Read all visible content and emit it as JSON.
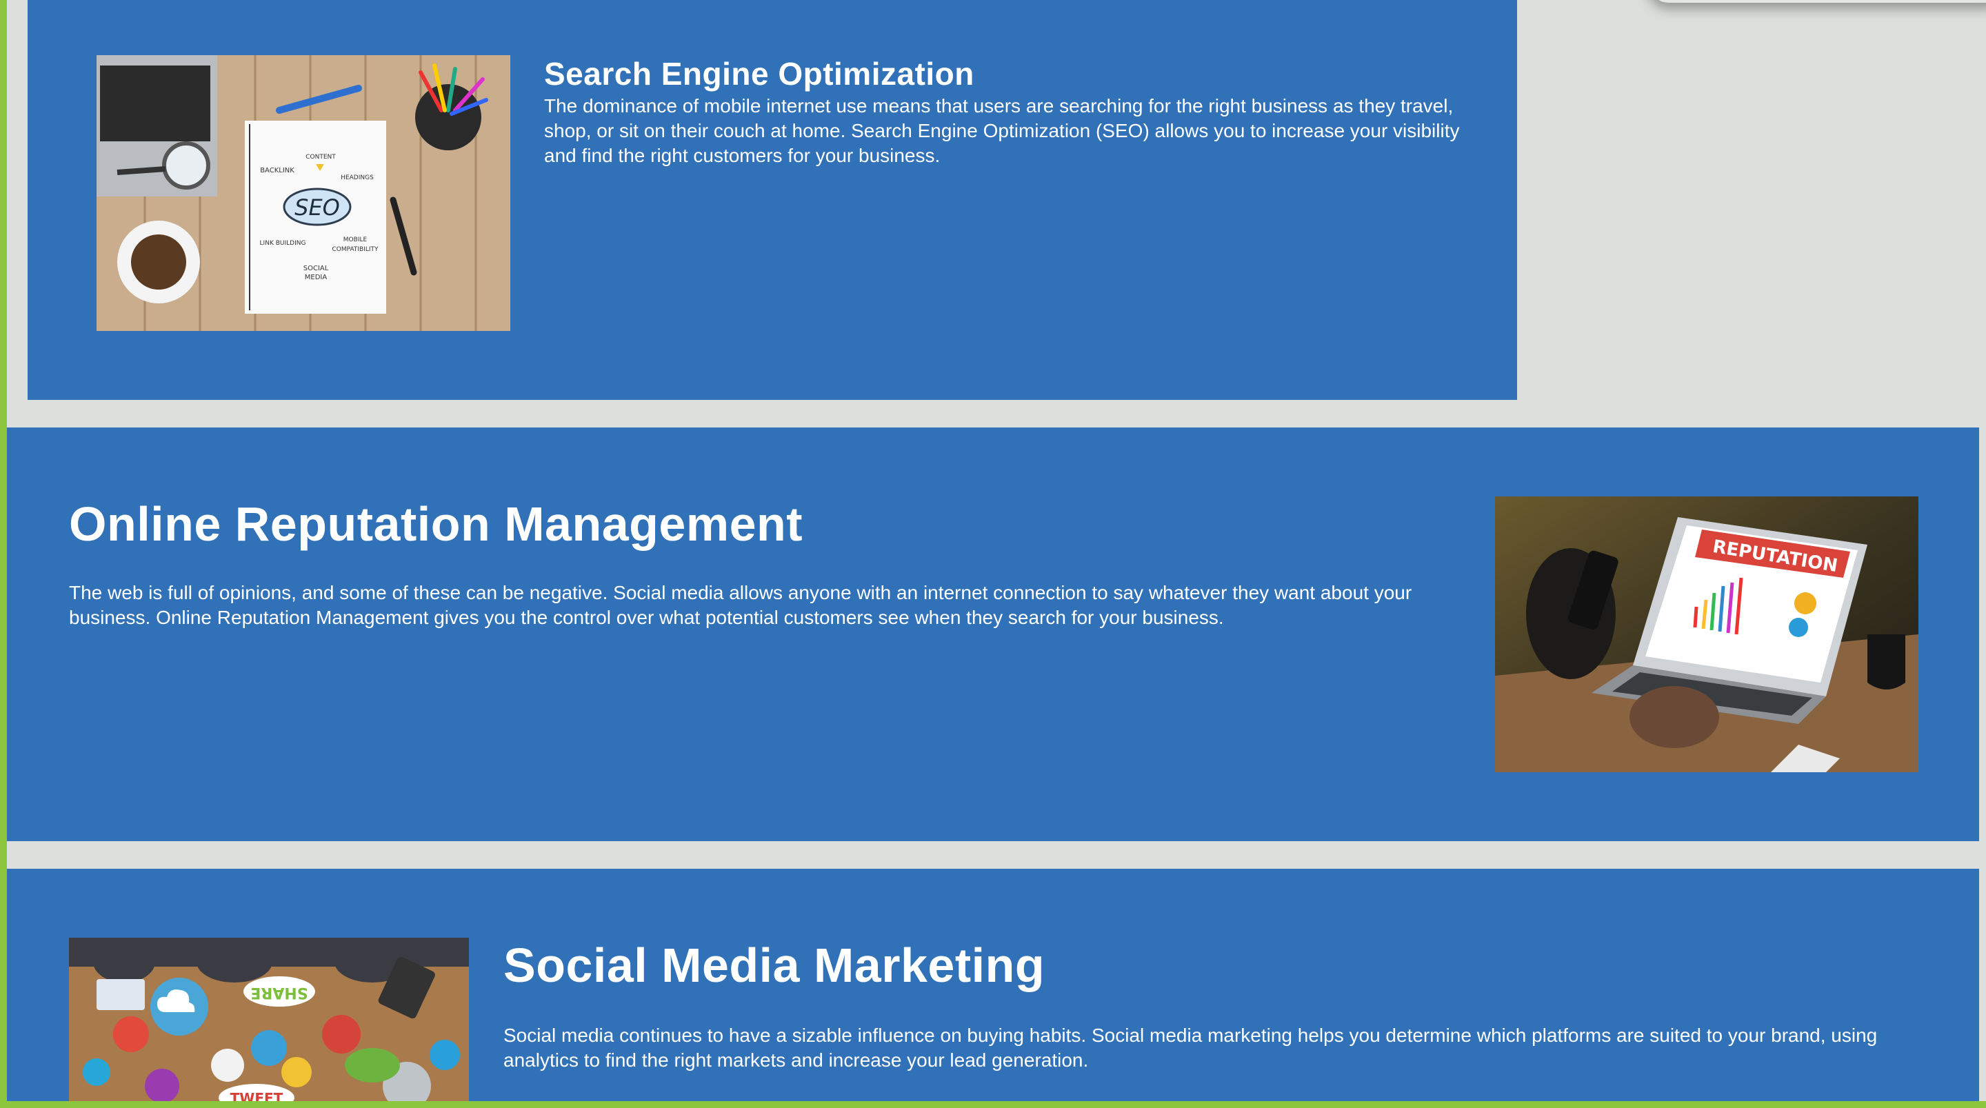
{
  "sections": [
    {
      "title": "Search Engine Optimization",
      "text": "The dominance of mobile internet use means that users are searching for the right business as they travel, shop, or sit on their couch at home. Search Engine Optimization (SEO) allows you to increase your visibility and find the right customers for your business.",
      "image_text": {
        "seo": "SEO",
        "content": "CONTENT",
        "backlink": "BACKLINK",
        "headings": "HEADINGS",
        "link_building": "LINK BUILDING",
        "mobile": "MOBILE",
        "compatibility": "COMPATIBILITY",
        "social": "SOCIAL",
        "media": "MEDIA"
      }
    },
    {
      "title": "Online Reputation Management",
      "text": "The web is full of opinions, and some of these can be negative. Social media allows anyone with an internet connection to say whatever they want about your business. Online Reputation Management gives you the control over what potential customers see when they search for your business.",
      "image_text": {
        "banner": "REPUTATION"
      }
    },
    {
      "title": "Social Media Marketing",
      "text": "Social media continues to have a sizable influence on buying habits. Social media marketing helps you determine which platforms are suited to your brand, using analytics to find the right markets and increase your lead generation.",
      "image_text": {
        "share": "SHARE",
        "tweet": "TWEET"
      }
    }
  ],
  "colors": {
    "section_bg": "#3071b7",
    "page_bg": "#dcdfdb",
    "frame": "#8cc63f"
  }
}
